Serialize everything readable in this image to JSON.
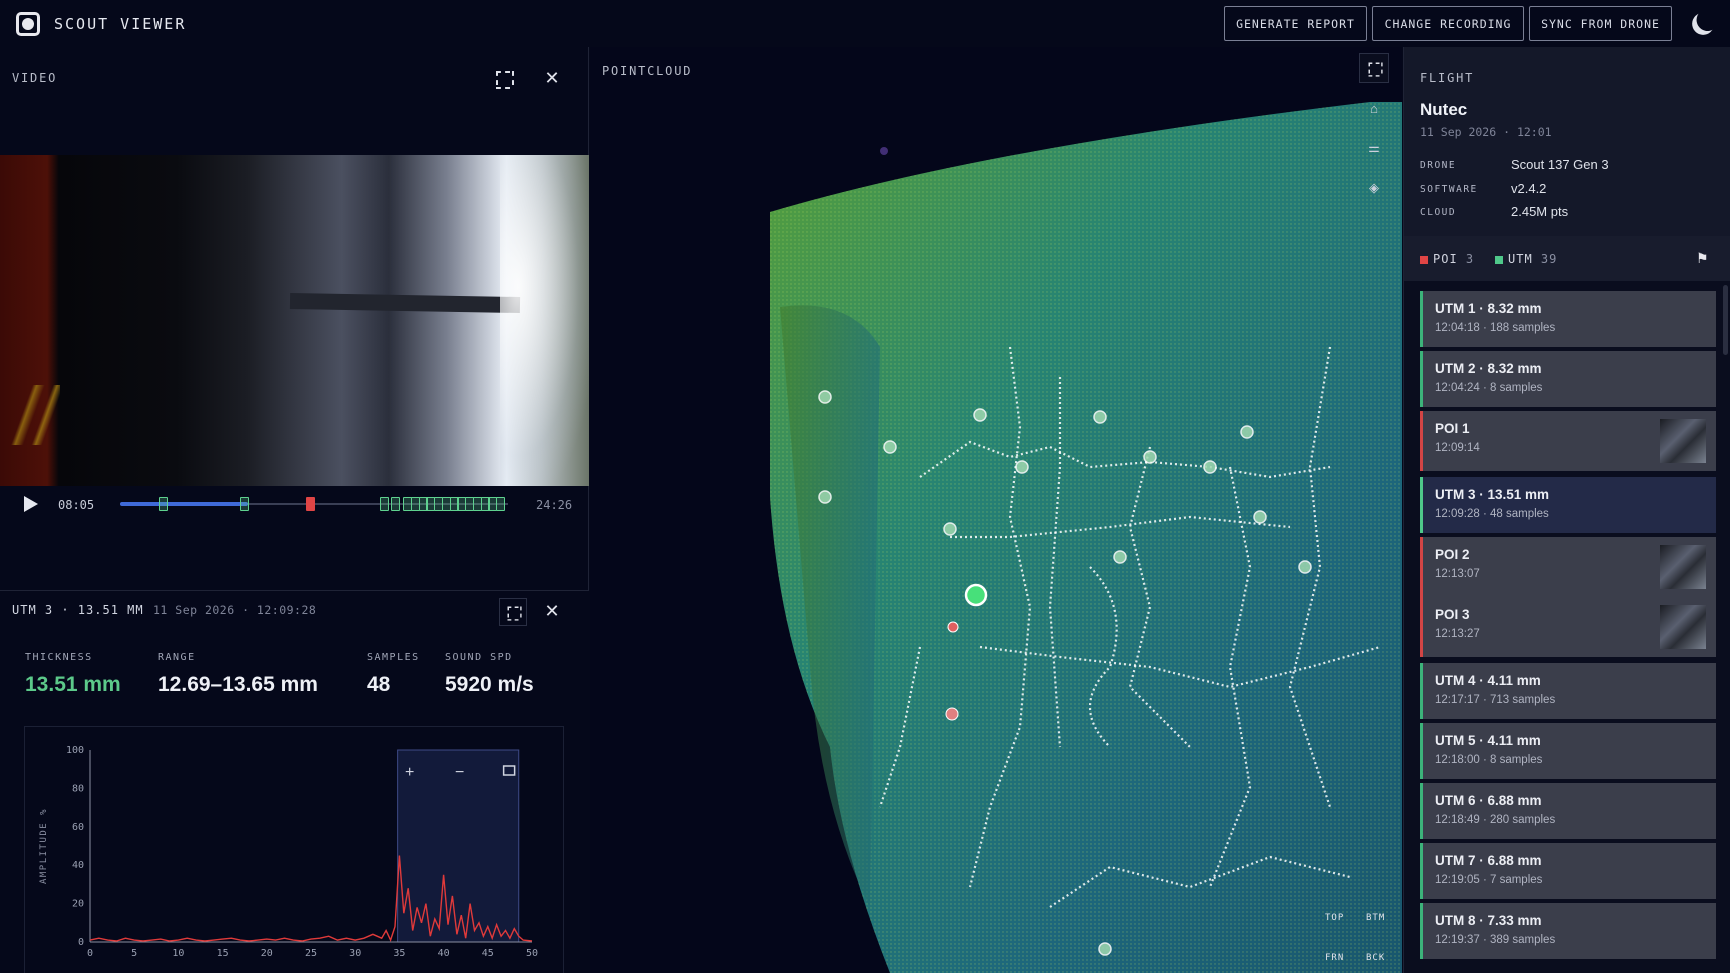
{
  "app": {
    "title": "SCOUT VIEWER"
  },
  "toolbar": {
    "generate_report": "GENERATE REPORT",
    "change_recording": "CHANGE RECORDING",
    "sync_from_drone": "SYNC FROM DRONE",
    "theme_icon": "moon-icon"
  },
  "video": {
    "label": "VIDEO",
    "time_current": "08:05",
    "time_total": "24:26",
    "progress": 0.33,
    "markers": [
      {
        "type": "UTM",
        "position": 0.11,
        "color": "#5fd28f"
      },
      {
        "type": "UTM",
        "position": 0.32,
        "color": "#5fd28f"
      },
      {
        "type": "POI",
        "position": 0.49,
        "color": "#e04545"
      },
      {
        "type": "UTM",
        "position": 0.68,
        "color": "#5fd28f"
      },
      {
        "type": "UTM",
        "position": 0.71,
        "color": "#5fd28f"
      },
      {
        "type": "UTM",
        "position": 0.74,
        "color": "#5fd28f"
      },
      {
        "type": "UTM",
        "position": 0.76,
        "color": "#5fd28f"
      },
      {
        "type": "UTM",
        "position": 0.78,
        "color": "#5fd28f"
      },
      {
        "type": "UTM",
        "position": 0.8,
        "color": "#5fd28f"
      },
      {
        "type": "UTM",
        "position": 0.82,
        "color": "#5fd28f"
      },
      {
        "type": "UTM",
        "position": 0.84,
        "color": "#5fd28f"
      },
      {
        "type": "UTM",
        "position": 0.86,
        "color": "#5fd28f"
      },
      {
        "type": "UTM",
        "position": 0.88,
        "color": "#5fd28f"
      },
      {
        "type": "UTM",
        "position": 0.9,
        "color": "#5fd28f"
      },
      {
        "type": "UTM",
        "position": 0.92,
        "color": "#5fd28f"
      },
      {
        "type": "UTM",
        "position": 0.94,
        "color": "#5fd28f"
      },
      {
        "type": "UTM",
        "position": 0.96,
        "color": "#5fd28f"
      },
      {
        "type": "UTM",
        "position": 0.98,
        "color": "#5fd28f"
      }
    ]
  },
  "detail": {
    "title": "UTM 3 · 13.51 MM",
    "date": "11 Sep 2026 · 12:09:28",
    "metrics": [
      {
        "label": "THICKNESS",
        "value": "13.51 mm",
        "color": "#5cc98a"
      },
      {
        "label": "RANGE",
        "value": "12.69–13.65 mm",
        "color": "#eef0f6"
      },
      {
        "label": "SAMPLES",
        "value": "48",
        "color": "#eef0f6"
      },
      {
        "label": "SOUND SPD",
        "value": "5920 m/s",
        "color": "#eef0f6"
      }
    ]
  },
  "chart_data": {
    "type": "line",
    "title": "",
    "xlabel": "",
    "ylabel": "AMPLITUDE %",
    "xlim": [
      0,
      50
    ],
    "ylim": [
      0,
      100
    ],
    "x_ticks": [
      "0",
      "5",
      "10",
      "15",
      "20",
      "25",
      "30",
      "35",
      "40",
      "45",
      "50"
    ],
    "y_ticks": [
      "0",
      "20",
      "40",
      "60",
      "80",
      "100"
    ],
    "gate": [
      34.8,
      48.5
    ],
    "zoom_controls": {
      "zoom_in": "+",
      "zoom_out": "−",
      "fit": "fit-icon"
    },
    "series": [
      {
        "color": "#e03a3a",
        "x": [
          0,
          1,
          2,
          3,
          4,
          5,
          6,
          7,
          8,
          9,
          10,
          11,
          12,
          13,
          14,
          15,
          16,
          17,
          18,
          19,
          20,
          21,
          22,
          23,
          24,
          25,
          26,
          27,
          28,
          29,
          30,
          31,
          32,
          33,
          33.5,
          34,
          34.5,
          35,
          35.5,
          36,
          36.5,
          37,
          37.5,
          38,
          38.5,
          39,
          39.5,
          40,
          40.5,
          41,
          41.5,
          42,
          42.5,
          43,
          43.5,
          44,
          44.5,
          45,
          45.5,
          46,
          46.5,
          47,
          47.5,
          48,
          48.5,
          49,
          50
        ],
        "y": [
          1,
          2,
          1,
          0.5,
          2,
          1,
          0.5,
          1,
          1.5,
          0.5,
          1,
          2,
          1,
          0.5,
          1,
          1.5,
          2,
          1,
          0.5,
          1,
          1.5,
          1,
          2,
          1,
          0.5,
          1.5,
          2,
          3,
          1,
          2,
          1,
          2,
          4,
          2,
          6,
          1,
          8,
          45,
          15,
          28,
          6,
          18,
          10,
          20,
          3,
          12,
          7,
          35,
          9,
          24,
          4,
          14,
          2,
          20,
          6,
          10,
          3,
          8,
          2,
          9,
          3,
          6,
          2,
          7,
          3,
          1,
          0.5
        ]
      }
    ]
  },
  "pointcloud": {
    "label": "POINTCLOUD",
    "tools": [
      "expand-icon",
      "home-icon",
      "sliders-icon",
      "layers-icon"
    ],
    "views": [
      "TOP",
      "BTM",
      "FRN",
      "BCK"
    ]
  },
  "flight": {
    "label": "FLIGHT",
    "name": "Nutec",
    "date": "11 Sep 2026",
    "time": "12:01",
    "fields": [
      {
        "key": "DRONE",
        "value": "Scout 137 Gen 3"
      },
      {
        "key": "SOFTWARE",
        "value": "v2.4.2"
      },
      {
        "key": "CLOUD",
        "value": "2.45M pts"
      }
    ],
    "filters": [
      {
        "label": "POI",
        "count": "3",
        "color": "#e04545"
      },
      {
        "label": "UTM",
        "count": "39",
        "color": "#4fc88a"
      }
    ],
    "flag_icon": "flag-icon",
    "items": [
      {
        "type": "utm",
        "title": "UTM 1 · 8.32 mm",
        "sub": "12:04:18 · 188 samples"
      },
      {
        "type": "utm",
        "title": "UTM 2 · 8.32 mm",
        "sub": "12:04:24 · 8 samples"
      },
      {
        "type": "poi",
        "title": "POI 1",
        "sub": "12:09:14"
      },
      {
        "type": "utm",
        "title": "UTM 3 · 13.51 mm",
        "sub": "12:09:28 · 48 samples",
        "selected": true
      },
      {
        "type": "poi",
        "title": "POI 2",
        "sub": "12:13:07"
      },
      {
        "type": "poi",
        "title": "POI 3",
        "sub": "12:13:27"
      },
      {
        "type": "utm",
        "title": "UTM 4 · 4.11 mm",
        "sub": "12:17:17 · 713 samples"
      },
      {
        "type": "utm",
        "title": "UTM 5 · 4.11 mm",
        "sub": "12:18:00 · 8 samples"
      },
      {
        "type": "utm",
        "title": "UTM 6 · 6.88 mm",
        "sub": "12:18:49 · 280 samples"
      },
      {
        "type": "utm",
        "title": "UTM 7 · 6.88 mm",
        "sub": "12:19:05 · 7 samples"
      },
      {
        "type": "utm",
        "title": "UTM 8 · 7.33 mm",
        "sub": "12:19:37 · 389 samples"
      }
    ]
  }
}
